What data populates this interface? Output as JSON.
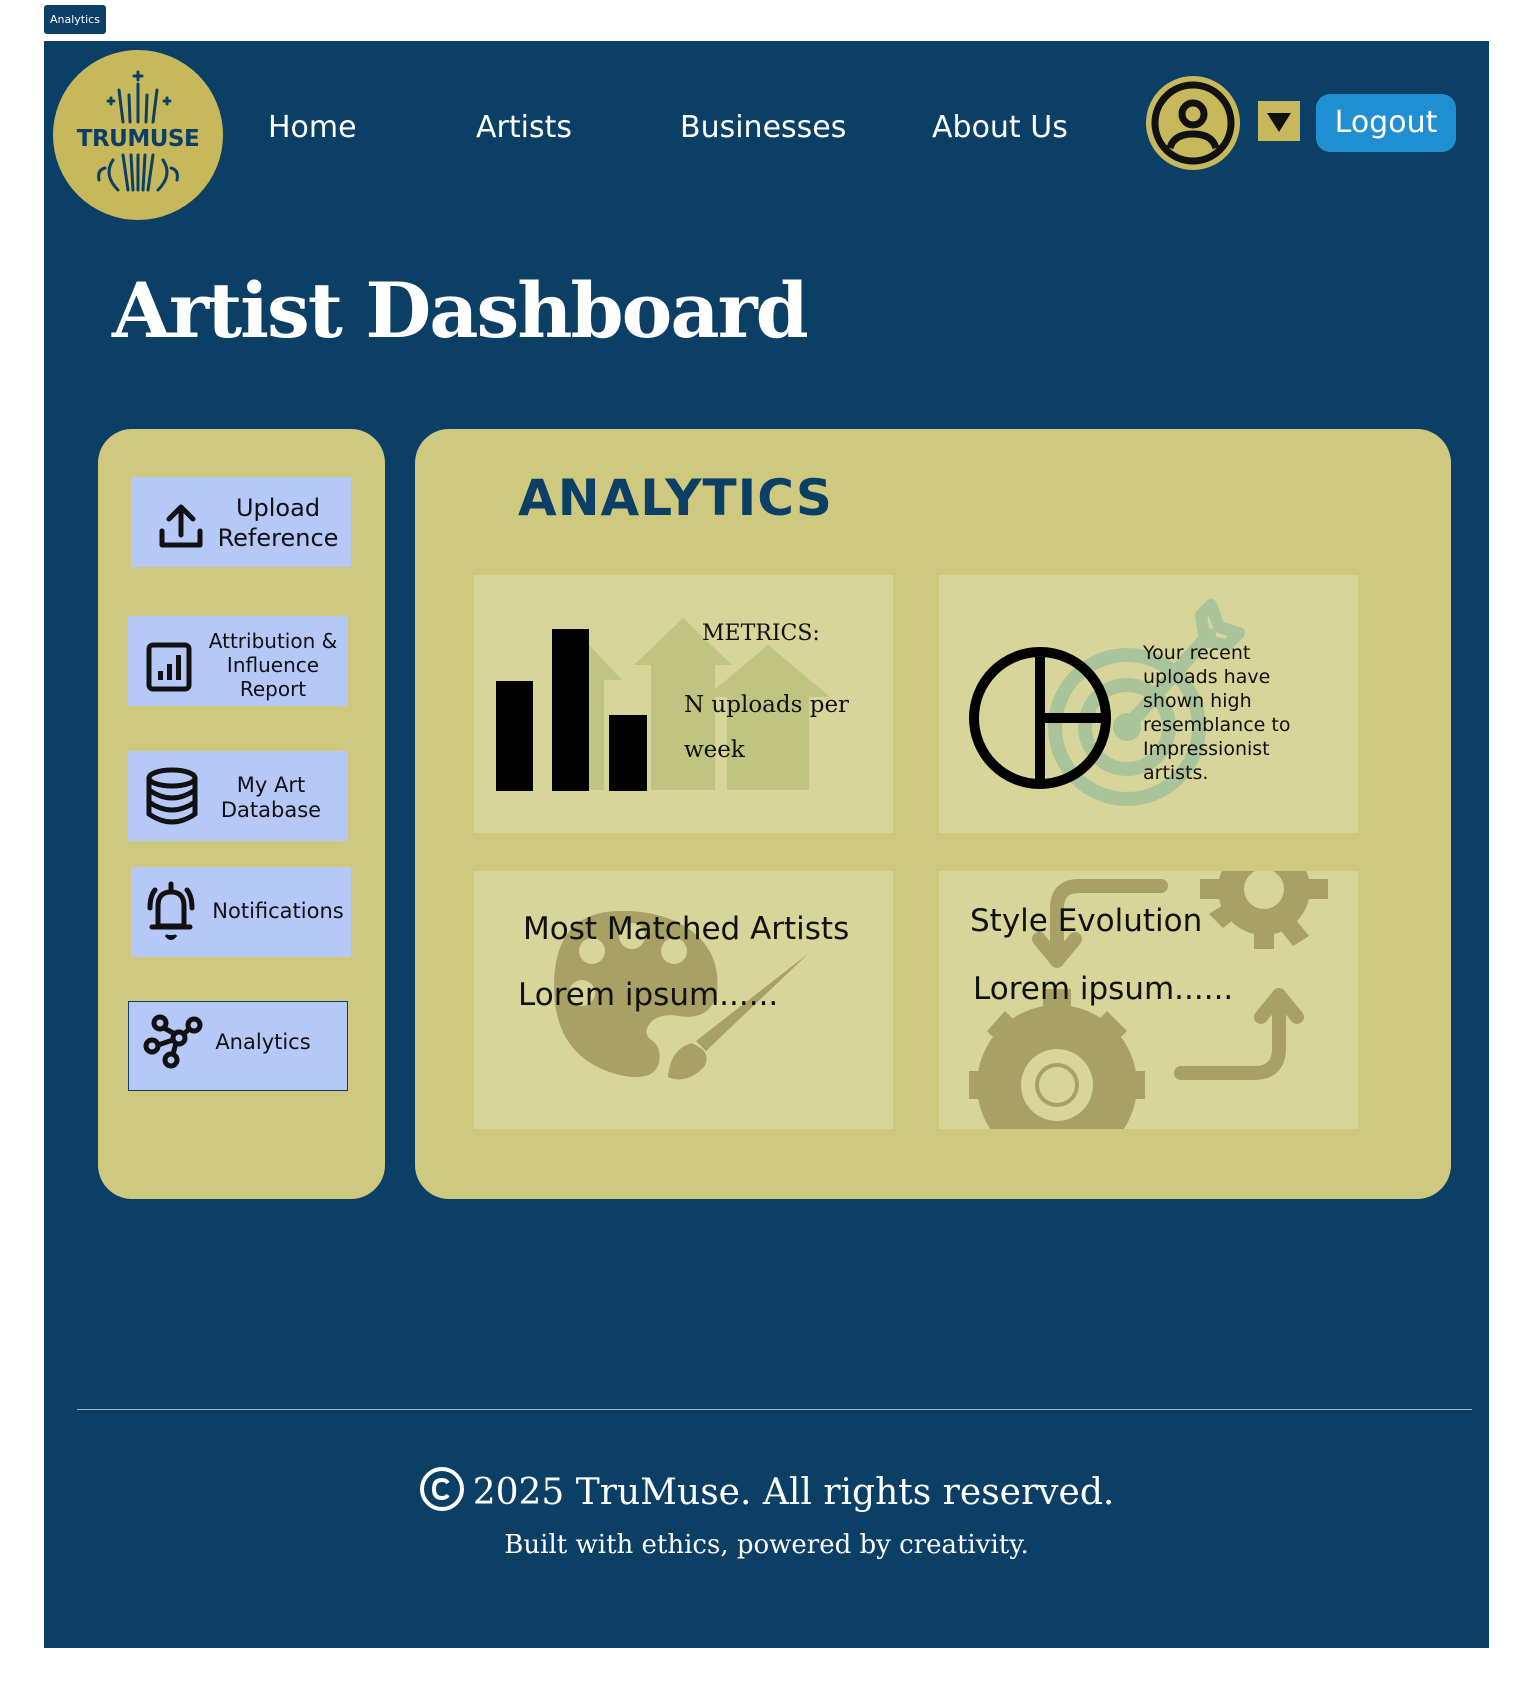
{
  "top_tag": "Analytics",
  "brand": {
    "logo_text": "TRUMUSE"
  },
  "nav": {
    "home": "Home",
    "artists": "Artists",
    "businesses": "Businesses",
    "about": "About Us"
  },
  "header": {
    "logout": "Logout"
  },
  "page": {
    "title": "Artist Dashboard"
  },
  "sidebar": {
    "items": [
      {
        "line1": "Upload",
        "line2": "Reference",
        "icon": "upload-icon"
      },
      {
        "line1": "Attribution &",
        "line2": "Influence",
        "line3": "Report",
        "icon": "report-chart-icon"
      },
      {
        "line1": "My Art",
        "line2": "Database",
        "icon": "database-icon"
      },
      {
        "line1": "Notifications",
        "icon": "bell-icon"
      },
      {
        "line1": "Analytics",
        "icon": "network-icon"
      }
    ]
  },
  "analytics": {
    "heading": "ANALYTICS",
    "metrics": {
      "title": "METRICS:",
      "line1": "N uploads per",
      "line2": "week"
    },
    "resemblance": {
      "l1": "Your recent",
      "l2": "uploads have",
      "l3": "shown high",
      "l4": "resemblance to",
      "l5": "Impressionist",
      "l6": "artists."
    },
    "matched": {
      "title": "Most Matched Artists",
      "body": "Lorem ipsum......"
    },
    "style": {
      "title": "Style Evolution",
      "body": "Lorem ipsum......"
    }
  },
  "footer": {
    "copyright": "2025 TruMuse. All rights reserved.",
    "tagline": "Built with ethics, powered by creativity."
  },
  "colors": {
    "navy": "#0b3f66",
    "gold": "#c7b85c",
    "panel": "#cfc980",
    "card": "#d8d59a",
    "button": "#b6c8f7",
    "logout": "#1f8fd1"
  }
}
